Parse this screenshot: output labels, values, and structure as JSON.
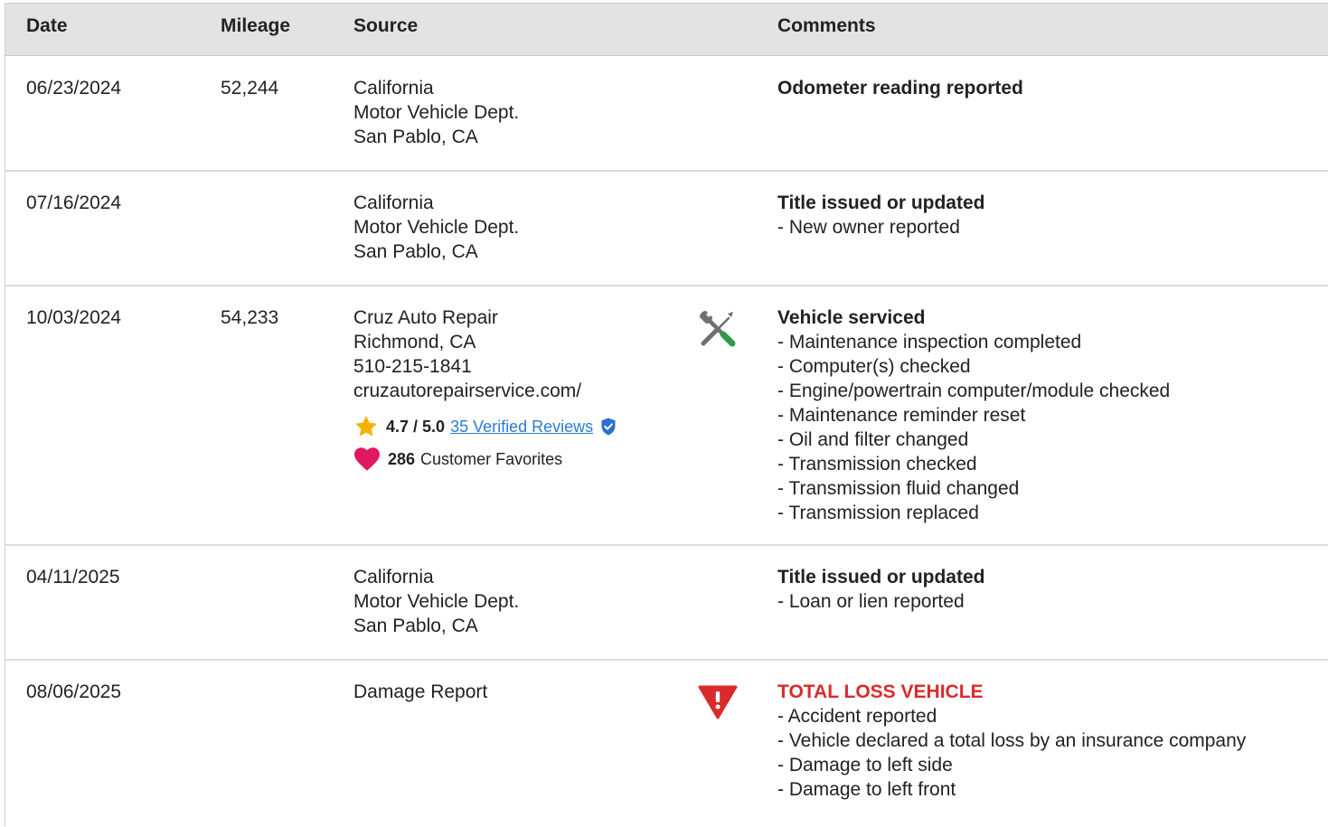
{
  "headers": {
    "date": "Date",
    "mileage": "Mileage",
    "source": "Source",
    "comments": "Comments"
  },
  "rows": [
    {
      "date": "06/23/2024",
      "mileage": "52,244",
      "source": [
        "California",
        "Motor Vehicle Dept.",
        "San Pablo, CA"
      ],
      "comment_title": "Odometer reading reported",
      "comment_items": []
    },
    {
      "date": "07/16/2024",
      "mileage": "",
      "source": [
        "California",
        "Motor Vehicle Dept.",
        "San Pablo, CA"
      ],
      "comment_title": "Title issued or updated",
      "comment_items": [
        "- New owner reported"
      ]
    },
    {
      "date": "10/03/2024",
      "mileage": "54,233",
      "source": [
        "Cruz Auto Repair",
        "Richmond, CA",
        "510-215-1841",
        "cruzautorepairservice.com/"
      ],
      "rating": "4.7 / 5.0",
      "reviews_link": "35 Verified Reviews",
      "favorites_count": "286",
      "favorites_label": "Customer Favorites",
      "icon": "service-tools-icon",
      "comment_title": "Vehicle serviced",
      "comment_items": [
        "- Maintenance inspection completed",
        "- Computer(s) checked",
        "- Engine/powertrain computer/module checked",
        "- Maintenance reminder reset",
        "- Oil and filter changed",
        "- Transmission checked",
        "- Transmission fluid changed",
        "- Transmission replaced"
      ]
    },
    {
      "date": "04/11/2025",
      "mileage": "",
      "source": [
        "California",
        "Motor Vehicle Dept.",
        "San Pablo, CA"
      ],
      "comment_title": "Title issued or updated",
      "comment_items": [
        "- Loan or lien reported"
      ]
    },
    {
      "date": "08/06/2025",
      "mileage": "",
      "source": [
        "Damage Report"
      ],
      "icon": "warning-triangle-icon",
      "comment_title": "TOTAL LOSS VEHICLE",
      "comment_items": [
        "- Accident reported",
        "- Vehicle declared a total loss by an insurance company",
        "- Damage to left side",
        "- Damage to left front"
      ]
    }
  ],
  "colors": {
    "header_bg": "#e3e3e3",
    "alert_red": "#d92b2b",
    "link_blue": "#2b7bd6",
    "star_gold": "#f5b301",
    "heart_pink": "#e0195f"
  }
}
